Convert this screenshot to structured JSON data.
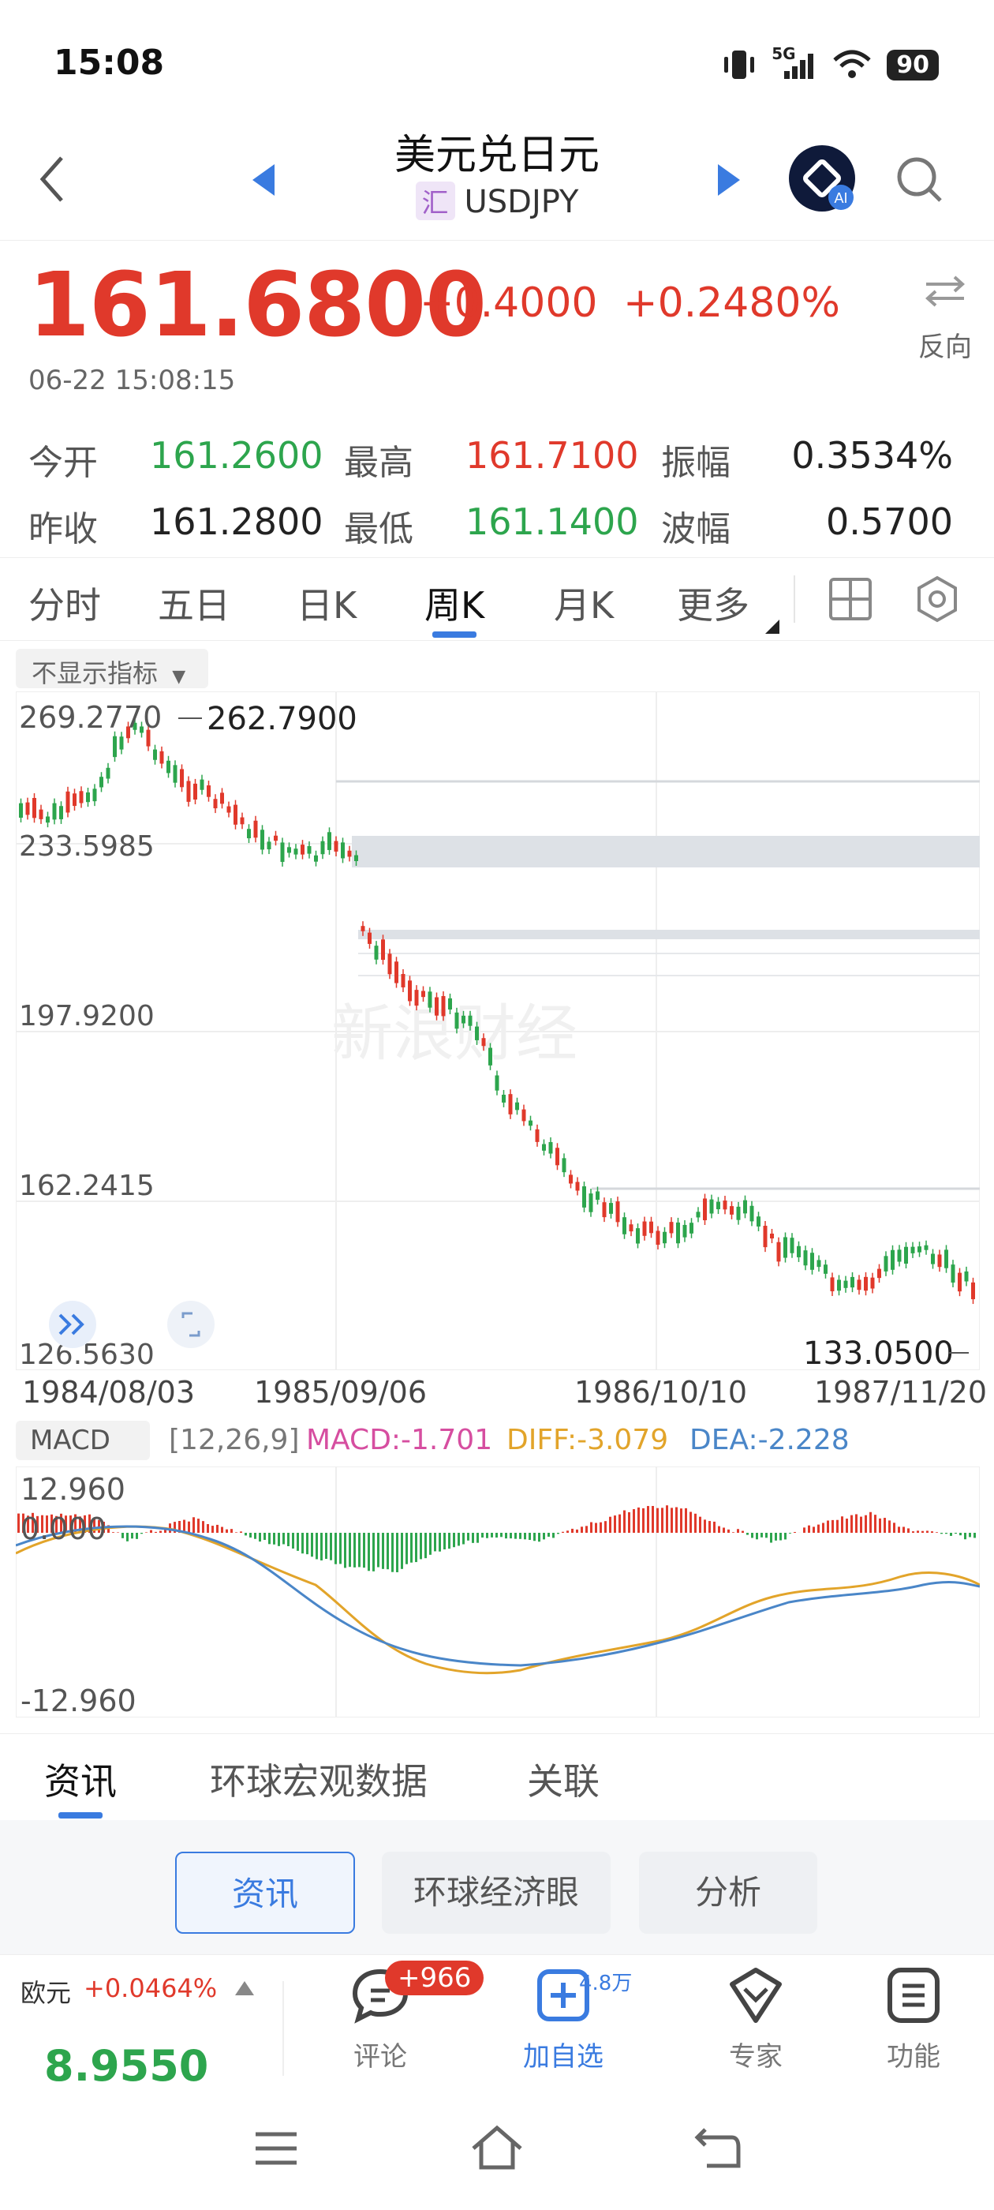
{
  "status": {
    "time": "15:08",
    "network": "5G",
    "battery": "90"
  },
  "header": {
    "title": "美元兑日元",
    "badge": "汇",
    "symbol": "USDJPY"
  },
  "quote": {
    "price": "161.6800",
    "change": "+0.4000",
    "change_pct": "+0.2480%",
    "reverse_label": "反向",
    "timestamp": "06-22 15:08:15"
  },
  "stats": [
    {
      "label": "今开",
      "value": "161.2600",
      "tone": "green"
    },
    {
      "label": "最高",
      "value": "161.7100",
      "tone": "red"
    },
    {
      "label": "振幅",
      "value": "0.3534%",
      "tone": "neutral"
    },
    {
      "label": "昨收",
      "value": "161.2800",
      "tone": "neutral"
    },
    {
      "label": "最低",
      "value": "161.1400",
      "tone": "green"
    },
    {
      "label": "波幅",
      "value": "0.5700",
      "tone": "neutral"
    }
  ],
  "tabs": [
    "分时",
    "五日",
    "日K",
    "周K",
    "月K",
    "更多"
  ],
  "active_tab": "周K",
  "indicator_toggle": "不显示指标",
  "main_chart": {
    "y_labels": [
      "269.2770",
      "233.5985",
      "197.9200",
      "162.2415",
      "126.5630"
    ],
    "high_label": "262.7900",
    "low_label": "133.0500",
    "watermark": "新浪财经",
    "dates": [
      "1984/08/03",
      "1985/09/06",
      "1986/10/10",
      "1987/11/20"
    ]
  },
  "macd": {
    "selector": "MACD",
    "params": "[12,26,9]",
    "macd_text": "MACD:-1.701",
    "diff_text": "DIFF:-3.079",
    "dea_text": "DEA:-2.228",
    "y_top": "12.960",
    "y_mid": "0.000",
    "y_bottom": "-12.960"
  },
  "colors": {
    "up": "#e0392b",
    "down": "#2da54d",
    "accent": "#3a7be0",
    "macd": "#d64ea0",
    "diff": "#e2a42a",
    "dea": "#4a86c8"
  },
  "chart_data": {
    "type": "line",
    "title": "",
    "x": [
      "1984/08/03",
      "1985/09/06",
      "1986/10/10",
      "1987/11/20"
    ],
    "series": [],
    "ylim": [
      126.563,
      269.277
    ],
    "grid": true
  },
  "bottom_tabs": [
    "资讯",
    "环球宏观数据",
    "关联"
  ],
  "sub_tabs": [
    "资讯",
    "环球经济眼",
    "分析"
  ],
  "footer": {
    "ticker_name": "欧元",
    "ticker_change": "+0.0464%",
    "ticker_price": "8.9550",
    "comment_label": "评论",
    "comment_badge": "+966",
    "watch_label": "加自选",
    "watch_count": "4.8万",
    "expert_label": "专家",
    "func_label": "功能"
  }
}
